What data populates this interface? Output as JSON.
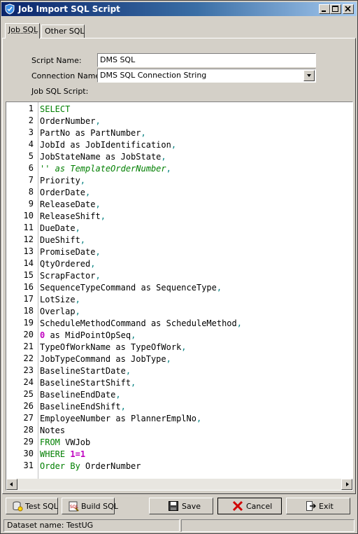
{
  "window": {
    "title": "Job Import SQL Script"
  },
  "tabs": [
    {
      "label": "Job SQL",
      "active": true
    },
    {
      "label": "Other SQL",
      "active": false
    }
  ],
  "form": {
    "script_name_label": "Script Name:",
    "script_name_value": "DMS SQL",
    "connection_name_label": "Connection Name:",
    "connection_name_value": "DMS SQL Connection String",
    "job_sql_script_label": "Job SQL Script:"
  },
  "editor": {
    "line_numbers": [
      "1",
      "2",
      "3",
      "4",
      "5",
      "6",
      "7",
      "8",
      "9",
      "10",
      "11",
      "12",
      "13",
      "14",
      "15",
      "16",
      "17",
      "18",
      "19",
      "20",
      "21",
      "22",
      "23",
      "24",
      "25",
      "26",
      "27",
      "28",
      "29",
      "30",
      "31"
    ],
    "lines": [
      "SELECT",
      "OrderNumber,",
      "PartNo as PartNumber,",
      "JobId as JobIdentification,",
      "JobStateName as JobState,",
      "'' as TemplateOrderNumber,",
      "Priority,",
      "OrderDate,",
      "ReleaseDate,",
      "ReleaseShift,",
      "DueDate,",
      "DueShift,",
      "PromiseDate,",
      "QtyOrdered,",
      "ScrapFactor,",
      "SequenceTypeCommand as SequenceType,",
      "LotSize,",
      "Overlap,",
      "ScheduleMethodCommand as ScheduleMethod,",
      "0 as MidPointOpSeq,",
      "TypeOfWorkName as TypeOfWork,",
      "JobTypeCommand as JobType,",
      "BaselineStartDate,",
      "BaselineStartShift,",
      "BaselineEndDate,",
      "BaselineEndShift,",
      "EmployeeNumber as PlannerEmplNo,",
      "Notes",
      "FROM VWJob",
      "WHERE 1=1",
      "Order By OrderNumber"
    ]
  },
  "buttons": {
    "test_sql": "Test SQL",
    "build_sql": "Build SQL",
    "save": "Save",
    "cancel": "Cancel",
    "exit": "Exit"
  },
  "status": {
    "dataset": "Dataset name:  TestUG"
  },
  "colors": {
    "keyword": "#007f00",
    "number": "#c000c0",
    "title_bar": "#0a246a"
  }
}
